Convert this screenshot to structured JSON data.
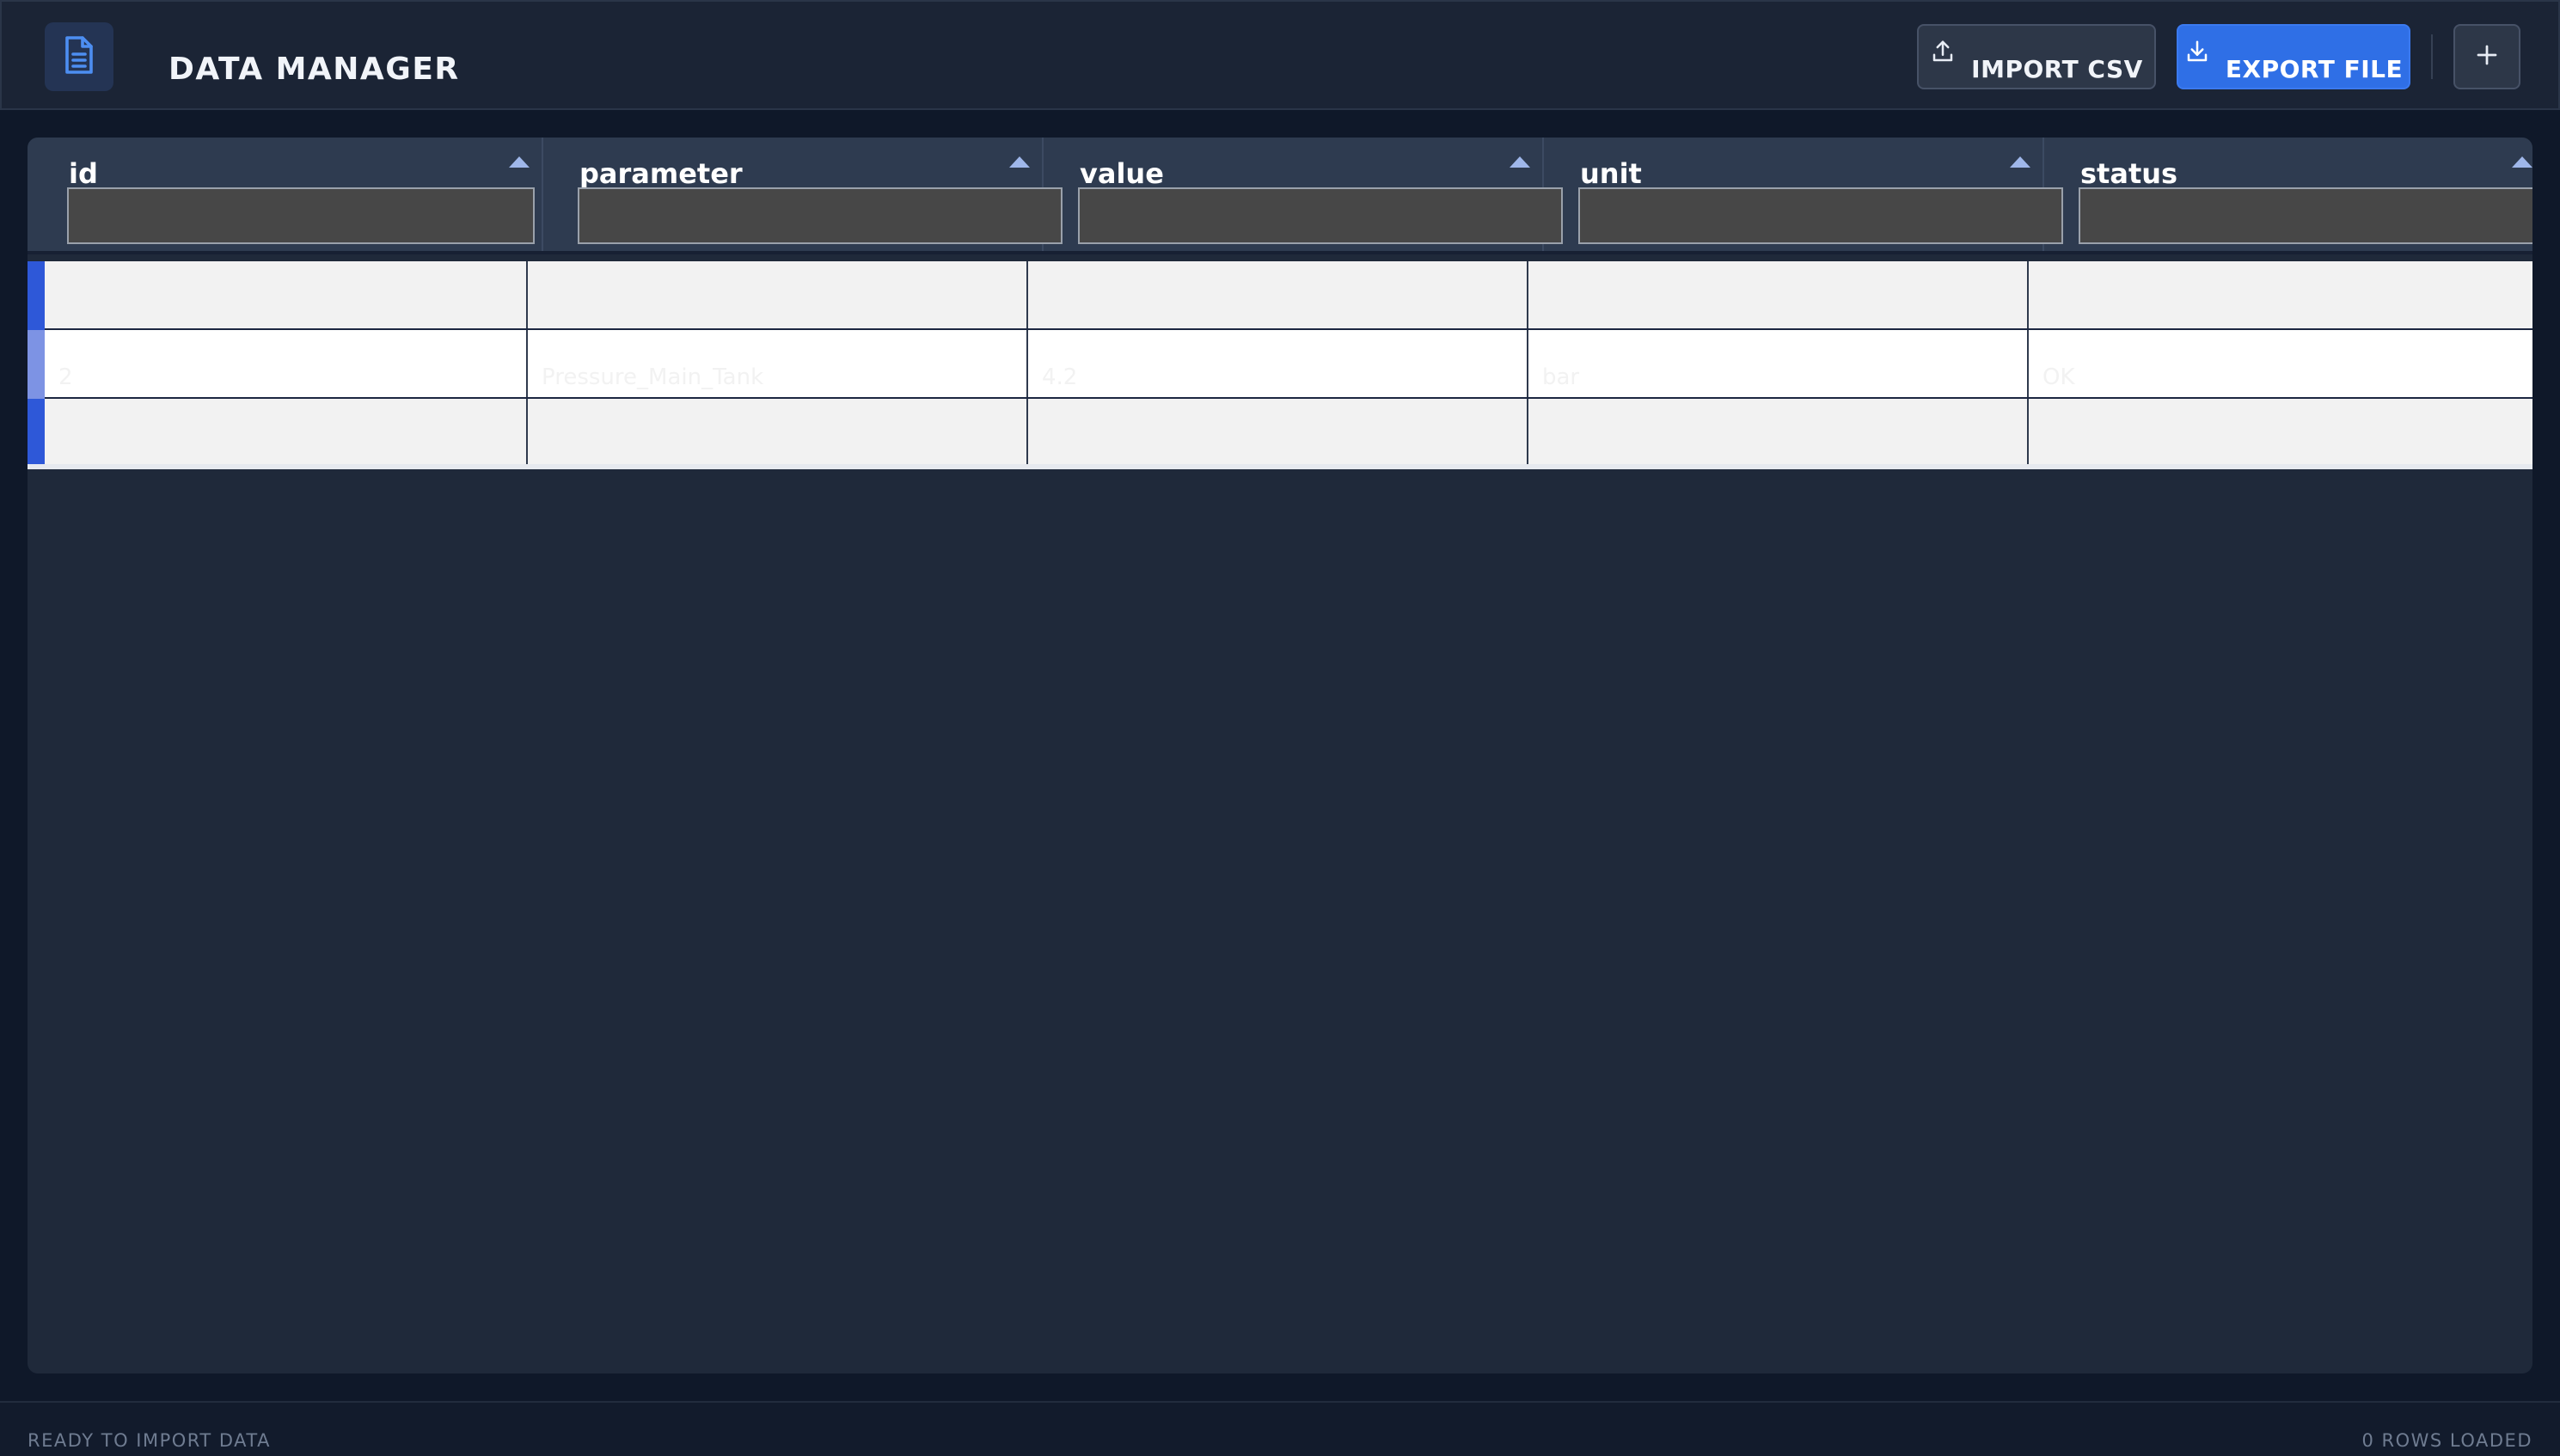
{
  "header": {
    "title": "DATA MANAGER",
    "logo_icon": "document-icon",
    "import_label": "IMPORT CSV",
    "import_icon": "upload-icon",
    "export_label": "EXPORT FILE",
    "export_icon": "download-icon",
    "add_icon": "plus-icon"
  },
  "grid": {
    "columns": [
      {
        "label": "id",
        "filter_value": ""
      },
      {
        "label": "parameter",
        "filter_value": ""
      },
      {
        "label": "value",
        "filter_value": ""
      },
      {
        "label": "unit",
        "filter_value": ""
      },
      {
        "label": "status",
        "filter_value": ""
      }
    ],
    "rows": [
      {
        "id": "",
        "parameter": "",
        "value": "",
        "unit": "",
        "status": ""
      },
      {
        "id": "2",
        "parameter": "Pressure_Main_Tank",
        "value": "4.2",
        "unit": "bar",
        "status": "OK"
      },
      {
        "id": "",
        "parameter": "",
        "value": "",
        "unit": "",
        "status": ""
      }
    ]
  },
  "status": {
    "left": "READY TO IMPORT DATA",
    "right": "0 ROWS LOADED"
  },
  "colors": {
    "accent": "#2f6fe6",
    "header_bg": "#1b2435",
    "panel_bg": "#1f293a",
    "row_marker": "#2e58d8"
  }
}
